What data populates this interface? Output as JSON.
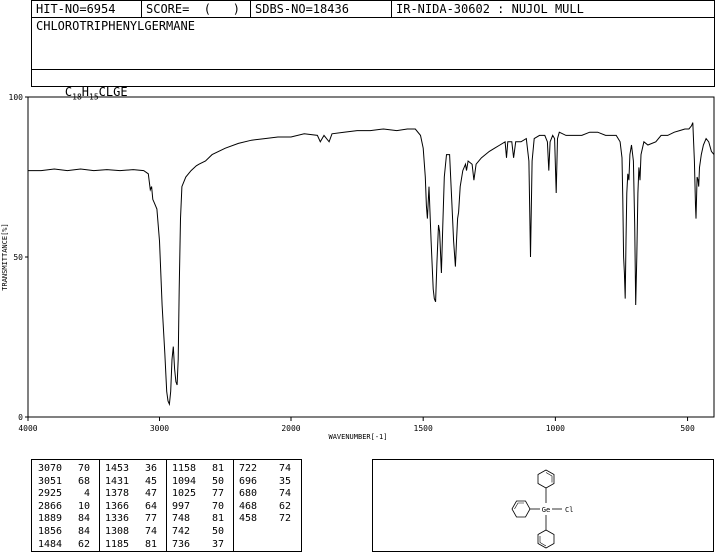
{
  "header": {
    "hit_no": "HIT-NO=6954",
    "score": "SCORE=  (   )",
    "sdbs_no": "SDBS-NO=18436",
    "ir_info": "IR-NIDA-30602 : NUJOL MULL",
    "compound_name": "CHLOROTRIPHENYLGERMANE",
    "formula_parts": {
      "c": "C",
      "c_sub": "18",
      "h": "H",
      "h_sub": "15",
      "rest": "CLGE"
    }
  },
  "structure": {
    "atom_ge": "Ge",
    "atom_cl": "Cl"
  },
  "peak_table": {
    "columns": [
      [
        [
          "3070",
          "70"
        ],
        [
          "3051",
          "68"
        ],
        [
          "2925",
          "4"
        ],
        [
          "2866",
          "10"
        ],
        [
          "1889",
          "84"
        ],
        [
          "1856",
          "84"
        ],
        [
          "1484",
          "62"
        ]
      ],
      [
        [
          "1453",
          "36"
        ],
        [
          "1431",
          "45"
        ],
        [
          "1378",
          "47"
        ],
        [
          "1366",
          "64"
        ],
        [
          "1336",
          "77"
        ],
        [
          "1308",
          "74"
        ],
        [
          "1185",
          "81"
        ]
      ],
      [
        [
          "1158",
          "81"
        ],
        [
          "1094",
          "50"
        ],
        [
          "1025",
          "77"
        ],
        [
          "997",
          "70"
        ],
        [
          "748",
          "81"
        ],
        [
          "742",
          "50"
        ],
        [
          "736",
          "37"
        ]
      ],
      [
        [
          "722",
          "74"
        ],
        [
          "696",
          "35"
        ],
        [
          "680",
          "74"
        ],
        [
          "468",
          "62"
        ],
        [
          "458",
          "72"
        ]
      ]
    ]
  },
  "chart_data": {
    "type": "line",
    "xlabel": "WAVENUMBER[-1]",
    "ylabel": "TRANSMITTANCE[%]",
    "xlim": [
      4000,
      400
    ],
    "ylim": [
      0,
      100
    ],
    "x_ticks": [
      4000,
      3000,
      2000,
      1500,
      1000,
      500
    ],
    "y_ticks": [
      0,
      50,
      100
    ],
    "series": [
      {
        "points": [
          [
            4000,
            77
          ],
          [
            3900,
            77
          ],
          [
            3800,
            77.5
          ],
          [
            3700,
            77
          ],
          [
            3600,
            77.5
          ],
          [
            3500,
            77
          ],
          [
            3400,
            77.3
          ],
          [
            3300,
            77
          ],
          [
            3200,
            77.3
          ],
          [
            3120,
            77
          ],
          [
            3085,
            76
          ],
          [
            3070,
            71
          ],
          [
            3060,
            72
          ],
          [
            3051,
            68
          ],
          [
            3040,
            67
          ],
          [
            3020,
            65
          ],
          [
            3000,
            55
          ],
          [
            2980,
            35
          ],
          [
            2960,
            20
          ],
          [
            2945,
            8
          ],
          [
            2935,
            5
          ],
          [
            2925,
            4
          ],
          [
            2915,
            8
          ],
          [
            2905,
            18
          ],
          [
            2895,
            22
          ],
          [
            2885,
            15
          ],
          [
            2875,
            11
          ],
          [
            2866,
            10
          ],
          [
            2858,
            18
          ],
          [
            2850,
            40
          ],
          [
            2840,
            62
          ],
          [
            2830,
            72
          ],
          [
            2800,
            75
          ],
          [
            2760,
            77
          ],
          [
            2720,
            78.5
          ],
          [
            2700,
            79
          ],
          [
            2650,
            80
          ],
          [
            2600,
            82
          ],
          [
            2500,
            84
          ],
          [
            2400,
            85.5
          ],
          [
            2300,
            86.5
          ],
          [
            2200,
            87
          ],
          [
            2100,
            87.5
          ],
          [
            2000,
            87.5
          ],
          [
            1950,
            88.5
          ],
          [
            1900,
            88
          ],
          [
            1889,
            86
          ],
          [
            1875,
            88
          ],
          [
            1856,
            86
          ],
          [
            1845,
            88.5
          ],
          [
            1800,
            89
          ],
          [
            1750,
            89.5
          ],
          [
            1700,
            89.5
          ],
          [
            1650,
            90
          ],
          [
            1600,
            89.5
          ],
          [
            1560,
            90
          ],
          [
            1530,
            90
          ],
          [
            1510,
            88
          ],
          [
            1500,
            84
          ],
          [
            1492,
            75
          ],
          [
            1488,
            66
          ],
          [
            1484,
            62
          ],
          [
            1478,
            72
          ],
          [
            1470,
            55
          ],
          [
            1462,
            40
          ],
          [
            1458,
            37
          ],
          [
            1453,
            36
          ],
          [
            1448,
            48
          ],
          [
            1442,
            60
          ],
          [
            1438,
            58
          ],
          [
            1431,
            45
          ],
          [
            1426,
            60
          ],
          [
            1420,
            75
          ],
          [
            1412,
            82
          ],
          [
            1400,
            82
          ],
          [
            1392,
            68
          ],
          [
            1385,
            55
          ],
          [
            1378,
            47
          ],
          [
            1374,
            55
          ],
          [
            1370,
            62
          ],
          [
            1366,
            64
          ],
          [
            1360,
            72
          ],
          [
            1350,
            77
          ],
          [
            1340,
            79
          ],
          [
            1336,
            77
          ],
          [
            1330,
            80
          ],
          [
            1315,
            79
          ],
          [
            1308,
            74
          ],
          [
            1300,
            79
          ],
          [
            1280,
            81
          ],
          [
            1250,
            83
          ],
          [
            1230,
            84
          ],
          [
            1210,
            85
          ],
          [
            1190,
            86
          ],
          [
            1185,
            81
          ],
          [
            1180,
            86
          ],
          [
            1165,
            86
          ],
          [
            1158,
            81
          ],
          [
            1150,
            86
          ],
          [
            1130,
            86
          ],
          [
            1110,
            87
          ],
          [
            1100,
            80
          ],
          [
            1094,
            50
          ],
          [
            1088,
            80
          ],
          [
            1080,
            87
          ],
          [
            1060,
            88
          ],
          [
            1040,
            88
          ],
          [
            1030,
            86
          ],
          [
            1025,
            77
          ],
          [
            1020,
            86
          ],
          [
            1010,
            88
          ],
          [
            1003,
            87
          ],
          [
            997,
            70
          ],
          [
            992,
            87
          ],
          [
            985,
            89
          ],
          [
            960,
            88
          ],
          [
            930,
            88
          ],
          [
            900,
            88
          ],
          [
            870,
            89
          ],
          [
            840,
            89
          ],
          [
            810,
            88
          ],
          [
            790,
            88
          ],
          [
            770,
            88
          ],
          [
            755,
            86
          ],
          [
            748,
            81
          ],
          [
            745,
            68
          ],
          [
            742,
            50
          ],
          [
            739,
            45
          ],
          [
            736,
            37
          ],
          [
            733,
            55
          ],
          [
            730,
            70
          ],
          [
            726,
            76
          ],
          [
            722,
            74
          ],
          [
            718,
            82
          ],
          [
            712,
            85
          ],
          [
            705,
            80
          ],
          [
            700,
            60
          ],
          [
            696,
            35
          ],
          [
            692,
            50
          ],
          [
            688,
            70
          ],
          [
            684,
            78
          ],
          [
            680,
            74
          ],
          [
            676,
            82
          ],
          [
            665,
            86
          ],
          [
            650,
            85
          ],
          [
            620,
            86
          ],
          [
            600,
            88
          ],
          [
            575,
            88
          ],
          [
            550,
            89
          ],
          [
            530,
            89.5
          ],
          [
            510,
            90
          ],
          [
            495,
            90
          ],
          [
            485,
            91
          ],
          [
            480,
            92
          ],
          [
            474,
            80
          ],
          [
            470,
            66
          ],
          [
            468,
            62
          ],
          [
            464,
            75
          ],
          [
            460,
            74
          ],
          [
            458,
            72
          ],
          [
            455,
            78
          ],
          [
            448,
            82
          ],
          [
            440,
            85
          ],
          [
            430,
            87
          ],
          [
            420,
            86
          ],
          [
            410,
            83
          ],
          [
            400,
            82
          ]
        ]
      }
    ]
  }
}
